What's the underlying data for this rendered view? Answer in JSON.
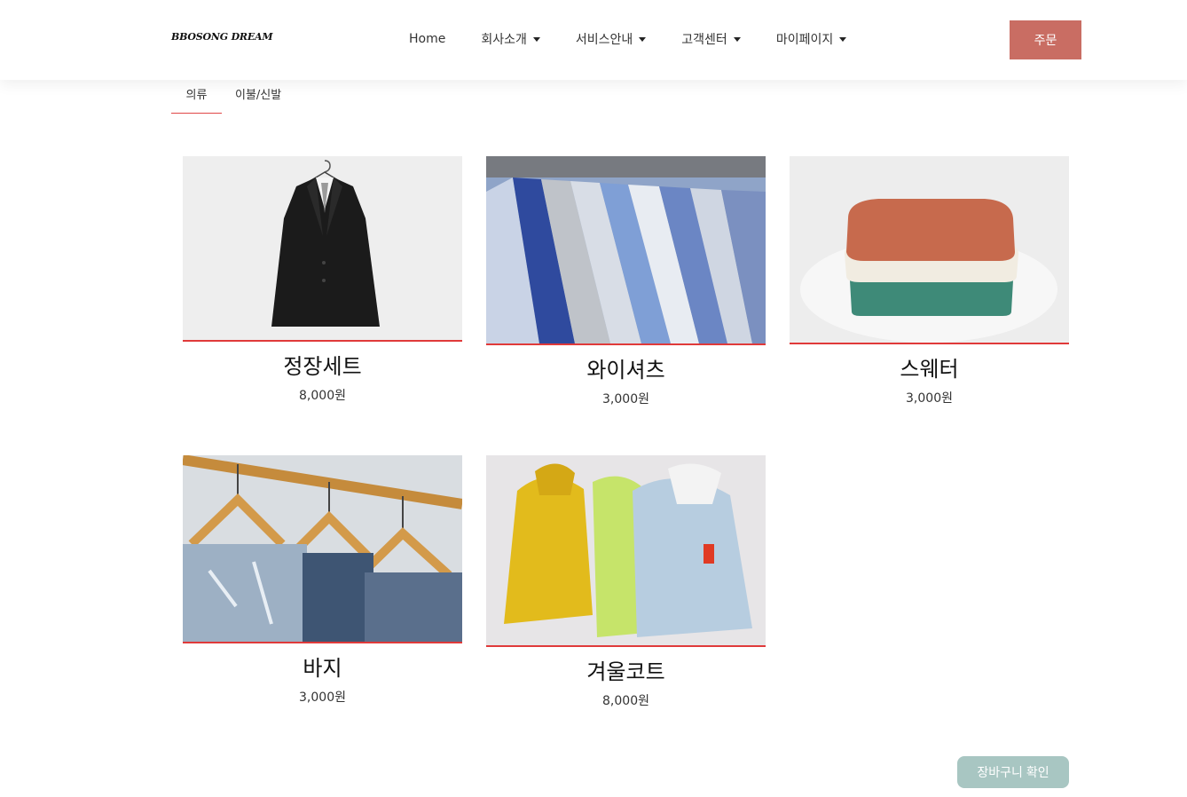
{
  "brand": "BBOSONG DREAM",
  "nav": {
    "items": [
      {
        "label": "Home",
        "dropdown": false
      },
      {
        "label": "회사소개",
        "dropdown": true
      },
      {
        "label": "서비스안내",
        "dropdown": true
      },
      {
        "label": "고객센터",
        "dropdown": true
      },
      {
        "label": "마이페이지",
        "dropdown": true
      }
    ],
    "order_label": "주문"
  },
  "tabs": [
    {
      "label": "의류",
      "active": true
    },
    {
      "label": "이불/신발",
      "active": false
    }
  ],
  "products": [
    {
      "name": "정장세트",
      "price": "8,000원",
      "image": "suit-on-hanger"
    },
    {
      "name": "와이셔츠",
      "price": "3,000원",
      "image": "dress-shirts-rack"
    },
    {
      "name": "스웨터",
      "price": "3,000원",
      "image": "folded-sweaters"
    },
    {
      "name": "바지",
      "price": "3,000원",
      "image": "jeans-on-hangers"
    },
    {
      "name": "겨울코트",
      "price": "8,000원",
      "image": "winter-coats"
    }
  ],
  "cart_label": "장바구니 확인",
  "colors": {
    "order_button": "#c96d63",
    "accent_underline": "#e03a3a",
    "cart_button": "#a8c6c2"
  }
}
